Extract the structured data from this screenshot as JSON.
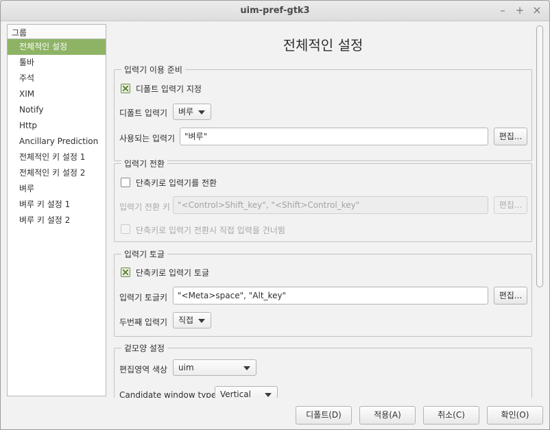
{
  "window": {
    "title": "uim-pref-gtk3",
    "min": "–",
    "max": "+",
    "close": "×"
  },
  "sidebar": {
    "header": "그룹",
    "items": [
      {
        "label": "전체적인 설정",
        "selected": true
      },
      {
        "label": "툴바"
      },
      {
        "label": "주석"
      },
      {
        "label": "XIM"
      },
      {
        "label": "Notify"
      },
      {
        "label": "Http"
      },
      {
        "label": "Ancillary Prediction"
      },
      {
        "label": "전체적인 키 설정 1"
      },
      {
        "label": "전체적인 키 설정 2"
      },
      {
        "label": "벼루"
      },
      {
        "label": "벼루 키 설정 1"
      },
      {
        "label": "벼루 키 설정 2"
      }
    ]
  },
  "main": {
    "title": "전체적인 설정",
    "im_prep": {
      "legend": "입력기 이용 준비",
      "default_im_check": "디폴트 입력기 지정",
      "default_im_label": "디폴트 입력기",
      "default_im_value": "벼루",
      "enabled_ims_label": "사용되는 입력기",
      "enabled_ims_value": "\"벼루\"",
      "edit": "편집..."
    },
    "im_switch": {
      "legend": "입력기 전환",
      "switch_check": "단축키로 입력기를 전환",
      "switch_key_label": "입력기 전환 키",
      "switch_key_value": "\"<Control>Shift_key\", \"<Shift>Control_key\"",
      "edit": "편집...",
      "skip_check": "단축키로 입력기 전환시 직접 입력을 건너뜀"
    },
    "im_toggle": {
      "legend": "입력기 토글",
      "toggle_check": "단축키로 입력기 토글",
      "toggle_key_label": "입력기 토글키",
      "toggle_key_value": "\"<Meta>space\", \"Alt_key\"",
      "edit": "편집...",
      "second_im_label": "두번째 입력기",
      "second_im_value": "직접"
    },
    "appearance": {
      "legend": "겉모양 설정",
      "preedit_color_label": "편집영역 색상",
      "preedit_color_value": "uim",
      "candidate_type_label": "Candidate window type",
      "candidate_type_value": "Vertical"
    }
  },
  "buttons": {
    "defaults": "디폴트(D)",
    "apply": "적용(A)",
    "cancel": "취소(C)",
    "ok": "확인(O)"
  },
  "colors": {
    "accent": "#8eb365"
  }
}
